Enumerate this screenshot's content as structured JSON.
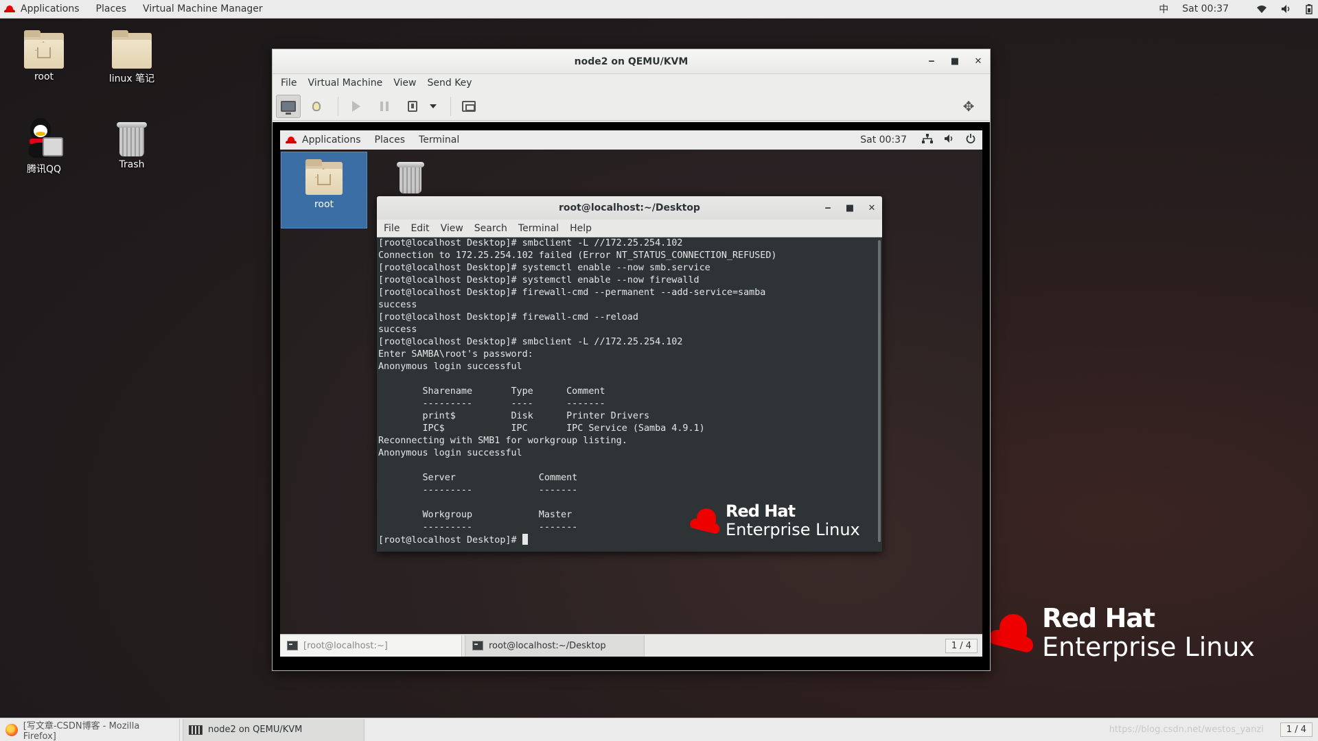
{
  "host": {
    "topbar": {
      "applications": "Applications",
      "places": "Places",
      "app_menu": "Virtual Machine Manager",
      "input_method": "中",
      "clock": "Sat 00:37"
    },
    "desktop_icons": {
      "root": "root",
      "linux_notes": "linux 笔记",
      "qq": "腾讯QQ",
      "trash": "Trash"
    },
    "logo": {
      "line1": "Red Hat",
      "line2": "Enterprise Linux"
    },
    "taskbar": {
      "firefox": "[写文章-CSDN博客 - Mozilla Firefox]",
      "vmm": "node2 on QEMU/KVM",
      "watermark": "https://blog.csdn.net/westos_yanzi",
      "pager": "1 / 4"
    }
  },
  "vm": {
    "title": "node2 on QEMU/KVM",
    "menu": [
      "File",
      "Virtual Machine",
      "View",
      "Send Key"
    ]
  },
  "guest": {
    "topbar": {
      "applications": "Applications",
      "places": "Places",
      "terminal": "Terminal",
      "clock": "Sat 00:37"
    },
    "desktop_icons": {
      "root": "root"
    },
    "terminal": {
      "title": "root@localhost:~/Desktop",
      "menu": [
        "File",
        "Edit",
        "View",
        "Search",
        "Terminal",
        "Help"
      ],
      "output": "[root@localhost Desktop]# smbclient -L //172.25.254.102\nConnection to 172.25.254.102 failed (Error NT_STATUS_CONNECTION_REFUSED)\n[root@localhost Desktop]# systemctl enable --now smb.service\n[root@localhost Desktop]# systemctl enable --now firewalld\n[root@localhost Desktop]# firewall-cmd --permanent --add-service=samba\nsuccess\n[root@localhost Desktop]# firewall-cmd --reload\nsuccess\n[root@localhost Desktop]# smbclient -L //172.25.254.102\nEnter SAMBA\\root's password: \nAnonymous login successful\n\n\tSharename       Type      Comment\n\t---------       ----      -------\n\tprint$          Disk      Printer Drivers\n\tIPC$            IPC       IPC Service (Samba 4.9.1)\nReconnecting with SMB1 for workgroup listing.\nAnonymous login successful\n\n\tServer               Comment\n\t---------            -------\n\n\tWorkgroup            Master\n\t---------            -------\n",
      "prompt": "[root@localhost Desktop]# "
    },
    "logo": {
      "line1": "Red Hat",
      "line2": "Enterprise Linux"
    },
    "taskbar": {
      "task1": "[root@localhost:~]",
      "task2": "root@localhost:~/Desktop",
      "pager": "1 / 4"
    }
  }
}
